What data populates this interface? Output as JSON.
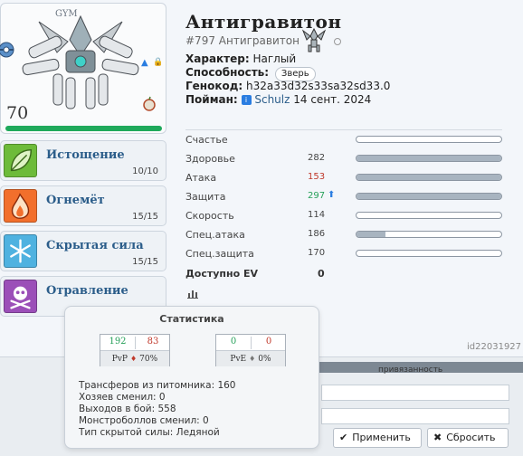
{
  "pokemon": {
    "name": "Антигравитон",
    "dex_line": "#797 Антигравитон",
    "level": "70",
    "gym_tag": "GYM",
    "hp_fraction": 1.0
  },
  "info": {
    "nature_label": "Характер:",
    "nature_value": "Наглый",
    "ability_label": "Способность:",
    "ability_value": "Зверь",
    "genocode_label": "Генокод:",
    "genocode_value": "h32a33d32s33sa32sd33.0",
    "caught_label": "Пойман:",
    "caught_owner": "Schulz",
    "caught_date": "14 сент. 2024"
  },
  "moves": [
    {
      "name": "Истощение",
      "pp": "10/10",
      "color": "#6dbb3a",
      "icon": "leaf-icon"
    },
    {
      "name": "Огнемёт",
      "pp": "15/15",
      "color": "#f26f2c",
      "icon": "fire-icon"
    },
    {
      "name": "Скрытая сила",
      "pp": "15/15",
      "color": "#4fb2e0",
      "icon": "snowflake-icon"
    },
    {
      "name": "Отравление",
      "pp": "",
      "color": "#9b4fb8",
      "icon": "skull-icon"
    }
  ],
  "stats": [
    {
      "label": "Счастье",
      "value": "",
      "fraction": 0.0,
      "color": "#444"
    },
    {
      "label": "Здоровье",
      "value": "282",
      "fraction": 1.0,
      "color": "#444"
    },
    {
      "label": "Атака",
      "value": "153",
      "fraction": 1.0,
      "color": "#c0392b"
    },
    {
      "label": "Защита",
      "value": "297",
      "fraction": 1.0,
      "color": "#27a05a",
      "boost": true
    },
    {
      "label": "Скорость",
      "value": "114",
      "fraction": 0.0,
      "color": "#444"
    },
    {
      "label": "Спец.атака",
      "value": "186",
      "fraction": 0.2,
      "color": "#444"
    },
    {
      "label": "Спец.защита",
      "value": "170",
      "fraction": 0.0,
      "color": "#444"
    }
  ],
  "ev": {
    "label": "Доступно EV",
    "value": "0"
  },
  "record_id": "id22031927",
  "tooltip": {
    "title": "Статистика",
    "pvp": {
      "wins": "192",
      "losses": "83",
      "label": "PvP",
      "pct": "70%"
    },
    "pve": {
      "wins": "0",
      "losses": "0",
      "label": "PvE",
      "pct": "0%"
    },
    "lines": [
      "Трансферов из питомника: 160",
      "Хозяев сменил: 0",
      "Выходов в бой: 558",
      "Монстроболлов сменил: 0",
      "Тип скрытой силы: Ледяной"
    ]
  },
  "form": {
    "select_value": "привязанность",
    "apply_label": "Применить",
    "reset_label": "Сбросить"
  },
  "colors": {
    "hp_bar": "#1fa95b",
    "link": "#2b5d8a",
    "boost_arrow": "#2a7de1"
  }
}
